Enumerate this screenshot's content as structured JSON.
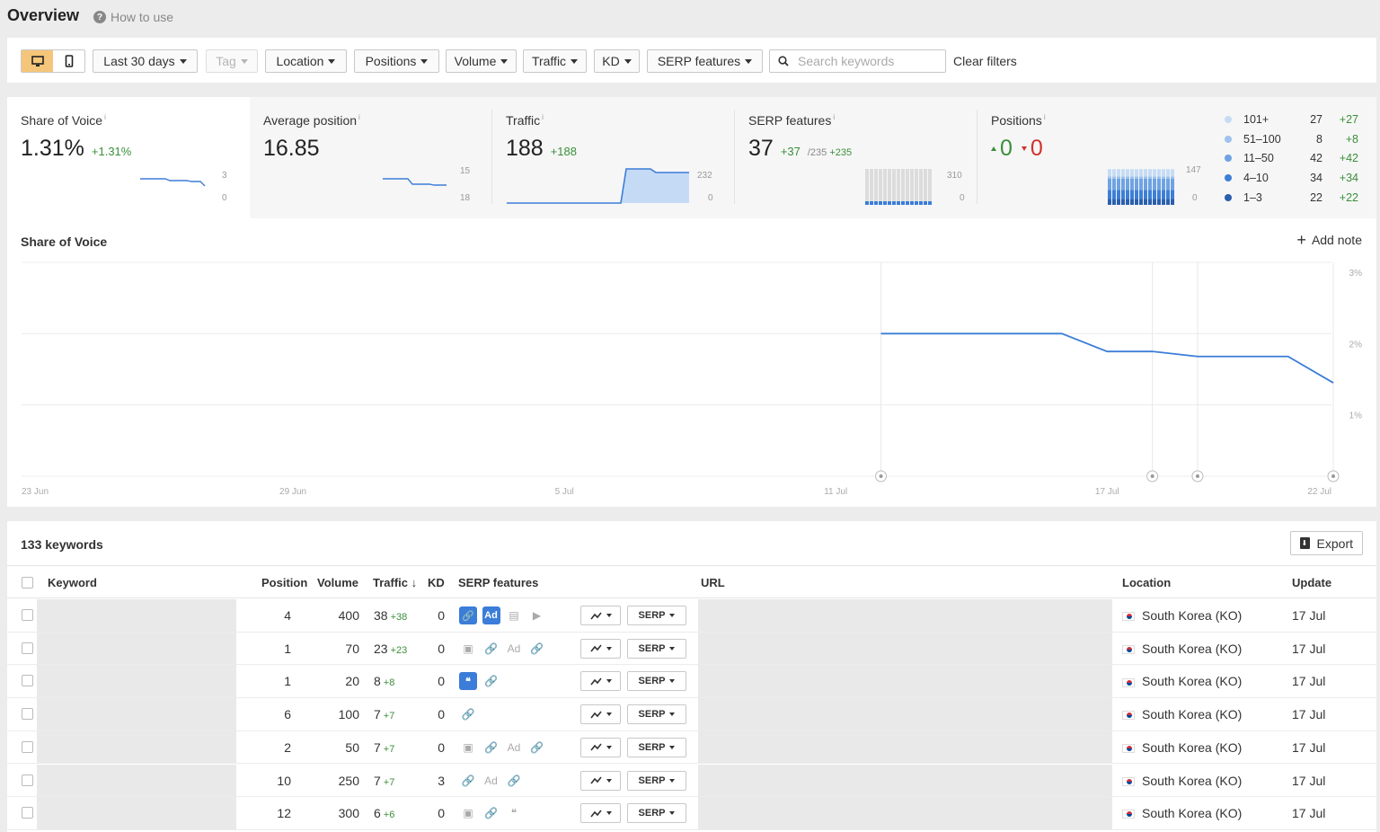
{
  "header": {
    "title": "Overview",
    "how_to_use": "How to use"
  },
  "filters": {
    "date": "Last 30 days",
    "tag": "Tag",
    "location": "Location",
    "positions": "Positions",
    "volume": "Volume",
    "traffic": "Traffic",
    "kd": "KD",
    "serp_features": "SERP features",
    "search_placeholder": "Search keywords",
    "clear": "Clear filters"
  },
  "metrics": {
    "share_of_voice": {
      "label": "Share of Voice",
      "info": "i",
      "value": "1.31%",
      "delta": "+1.31%",
      "axis_top": "3",
      "axis_bottom": "0"
    },
    "avg_position": {
      "label": "Average position",
      "info": "i",
      "value": "16.85",
      "axis_top": "15",
      "axis_bottom": "18"
    },
    "traffic": {
      "label": "Traffic",
      "info": "i",
      "value": "188",
      "delta": "+188",
      "axis_top": "232",
      "axis_bottom": "0"
    },
    "serp": {
      "label": "SERP features",
      "info": "i",
      "value": "37",
      "delta": "+37",
      "total": "/235",
      "total_delta": "+235",
      "axis_top": "310",
      "axis_bottom": "0"
    },
    "positions": {
      "label": "Positions",
      "info": "i",
      "up": "0",
      "down": "0",
      "axis_top": "147",
      "axis_bottom": "0"
    }
  },
  "positions_legend": [
    {
      "name": "101+",
      "count": "27",
      "delta": "+27",
      "color": "#c6dcf5"
    },
    {
      "name": "51–100",
      "count": "8",
      "delta": "+8",
      "color": "#9fc3ee"
    },
    {
      "name": "11–50",
      "count": "42",
      "delta": "+42",
      "color": "#6fa3e3"
    },
    {
      "name": "4–10",
      "count": "34",
      "delta": "+34",
      "color": "#3d7fd6"
    },
    {
      "name": "1–3",
      "count": "22",
      "delta": "+22",
      "color": "#2a5fad"
    }
  ],
  "sov_chart": {
    "title": "Share of Voice",
    "add_note": "Add note",
    "y_ticks": [
      "3%",
      "2%",
      "1%"
    ],
    "x_ticks": [
      "23 Jun",
      "29 Jun",
      "5 Jul",
      "11 Jul",
      "17 Jul",
      "22 Jul"
    ]
  },
  "chart_data": {
    "type": "line",
    "title": "Share of Voice",
    "xlabel": "",
    "ylabel": "",
    "ylim": [
      0,
      3
    ],
    "x": [
      "12 Jul",
      "13 Jul",
      "14 Jul",
      "15 Jul",
      "16 Jul",
      "17 Jul",
      "18 Jul",
      "19 Jul",
      "20 Jul",
      "21 Jul",
      "22 Jul"
    ],
    "series": [
      {
        "values": [
          2.0,
          2.0,
          2.0,
          2.0,
          2.0,
          1.75,
          1.75,
          1.68,
          1.68,
          1.68,
          1.31
        ]
      }
    ],
    "grid": true
  },
  "keywords": {
    "title": "133 keywords",
    "export": "Export",
    "columns": {
      "keyword": "Keyword",
      "position": "Position",
      "volume": "Volume",
      "traffic": "Traffic",
      "kd": "KD",
      "serp": "SERP features",
      "url": "URL",
      "location": "Location",
      "update": "Update"
    },
    "serp_button": "SERP",
    "rows": [
      {
        "position": "4",
        "volume": "400",
        "traffic": "38",
        "tdelta": "+38",
        "kd": "0",
        "location": "South Korea (KO)",
        "update": "17 Jul"
      },
      {
        "position": "1",
        "volume": "70",
        "traffic": "23",
        "tdelta": "+23",
        "kd": "0",
        "location": "South Korea (KO)",
        "update": "17 Jul"
      },
      {
        "position": "1",
        "volume": "20",
        "traffic": "8",
        "tdelta": "+8",
        "kd": "0",
        "location": "South Korea (KO)",
        "update": "17 Jul"
      },
      {
        "position": "6",
        "volume": "100",
        "traffic": "7",
        "tdelta": "+7",
        "kd": "0",
        "location": "South Korea (KO)",
        "update": "17 Jul"
      },
      {
        "position": "2",
        "volume": "50",
        "traffic": "7",
        "tdelta": "+7",
        "kd": "0",
        "location": "South Korea (KO)",
        "update": "17 Jul"
      },
      {
        "position": "10",
        "volume": "250",
        "traffic": "7",
        "tdelta": "+7",
        "kd": "3",
        "location": "South Korea (KO)",
        "update": "17 Jul"
      },
      {
        "position": "12",
        "volume": "300",
        "traffic": "6",
        "tdelta": "+6",
        "kd": "0",
        "location": "South Korea (KO)",
        "update": "17 Jul"
      }
    ]
  },
  "colors": {
    "accent": "#3b7dd8",
    "positive": "#3a8f3a",
    "negative": "#d0312d",
    "device_active": "#f5c67a"
  }
}
